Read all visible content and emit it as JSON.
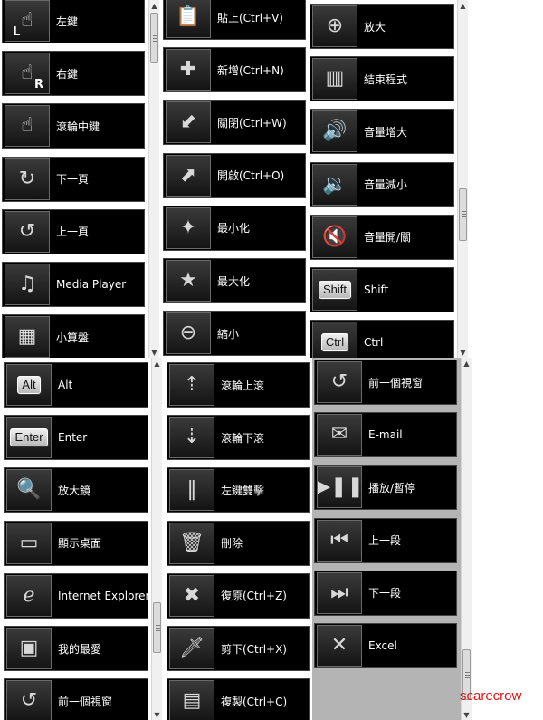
{
  "panels": [
    {
      "items": [
        {
          "label": "左鍵",
          "icon": "left-click-mouse-icon",
          "glyph": "☝",
          "corner": "L"
        },
        {
          "label": "右鍵",
          "icon": "right-click-mouse-icon",
          "glyph": "☝",
          "corner": "R"
        },
        {
          "label": "滾輪中鍵",
          "icon": "middle-click-mouse-icon",
          "glyph": "☝"
        },
        {
          "label": "下一頁",
          "icon": "next-page-icon",
          "glyph": "↻"
        },
        {
          "label": "上一頁",
          "icon": "previous-page-icon",
          "glyph": "↺"
        },
        {
          "label": "Media Player",
          "icon": "media-player-icon",
          "glyph": "♫"
        },
        {
          "label": "小算盤",
          "icon": "calculator-icon",
          "glyph": "▦"
        }
      ]
    },
    {
      "items": [
        {
          "label": "貼上(Ctrl+V)",
          "icon": "paste-icon",
          "glyph": "📋"
        },
        {
          "label": "新增(Ctrl+N)",
          "icon": "new-plus-icon",
          "glyph": "✚"
        },
        {
          "label": "關閉(Ctrl+W)",
          "icon": "close-box-icon",
          "glyph": "⬋"
        },
        {
          "label": "開啟(Ctrl+O)",
          "icon": "open-box-icon",
          "glyph": "⬈"
        },
        {
          "label": "最小化",
          "icon": "minimize-star-icon",
          "glyph": "✦"
        },
        {
          "label": "最大化",
          "icon": "maximize-star-icon",
          "glyph": "★"
        },
        {
          "label": "縮小",
          "icon": "zoom-out-target-icon",
          "glyph": "⊖"
        }
      ]
    },
    {
      "items": [
        {
          "label": "放大",
          "icon": "zoom-in-target-icon",
          "glyph": "⊕"
        },
        {
          "label": "結束程式",
          "icon": "exit-program-bars-icon",
          "glyph": "▥"
        },
        {
          "label": "音量增大",
          "icon": "volume-up-icon",
          "glyph": "🔊"
        },
        {
          "label": "音量減小",
          "icon": "volume-down-icon",
          "glyph": "🔉"
        },
        {
          "label": "音量開/關",
          "icon": "mute-toggle-icon",
          "glyph": "🔇"
        },
        {
          "label": "Shift",
          "icon": "shift-key-icon",
          "key": "Shift"
        },
        {
          "label": "Ctrl",
          "icon": "ctrl-key-icon",
          "key": "Ctrl"
        }
      ]
    },
    {
      "items": [
        {
          "label": "Alt",
          "icon": "alt-key-icon",
          "key": "Alt"
        },
        {
          "label": "Enter",
          "icon": "enter-key-icon",
          "key": "Enter"
        },
        {
          "label": "放大鏡",
          "icon": "magnifier-icon",
          "glyph": "🔍"
        },
        {
          "label": "顯示桌面",
          "icon": "desktop-table-icon",
          "glyph": "▭"
        },
        {
          "label": "Internet Explorer",
          "icon": "internet-explorer-icon",
          "glyph": "ℯ"
        },
        {
          "label": "我的最愛",
          "icon": "favorites-chest-icon",
          "glyph": "▣"
        },
        {
          "label": "前一個視窗",
          "icon": "previous-window-icon",
          "glyph": "↺"
        }
      ]
    },
    {
      "items": [
        {
          "label": "滾輪上滾",
          "icon": "scroll-up-mouse-icon",
          "glyph": "⇡"
        },
        {
          "label": "滾輪下滾",
          "icon": "scroll-down-mouse-icon",
          "glyph": "⇣"
        },
        {
          "label": "左鍵雙擊",
          "icon": "double-click-bullets-icon",
          "glyph": "‖"
        },
        {
          "label": "刪除",
          "icon": "trash-bin-icon",
          "glyph": "🗑"
        },
        {
          "label": "復原(Ctrl+Z)",
          "icon": "undo-map-icon",
          "glyph": "✖"
        },
        {
          "label": "剪下(Ctrl+X)",
          "icon": "cut-knife-icon",
          "glyph": "🗡"
        },
        {
          "label": "複製(Ctrl+C)",
          "icon": "copy-paper-icon",
          "glyph": "▤"
        }
      ]
    },
    {
      "items": [
        {
          "label": "前一個視窗",
          "icon": "previous-window-icon",
          "glyph": "↺"
        },
        {
          "label": "E-mail",
          "icon": "mailbox-icon",
          "glyph": "✉"
        },
        {
          "label": "播放/暫停",
          "icon": "play-pause-icon",
          "glyph": "▶❚❚"
        },
        {
          "label": "上一段",
          "icon": "previous-track-icon",
          "glyph": "⏮"
        },
        {
          "label": "下一段",
          "icon": "next-track-icon",
          "glyph": "⏭"
        },
        {
          "label": "Excel",
          "icon": "excel-icon",
          "glyph": "✕"
        }
      ]
    }
  ],
  "signature": "scarecrow"
}
